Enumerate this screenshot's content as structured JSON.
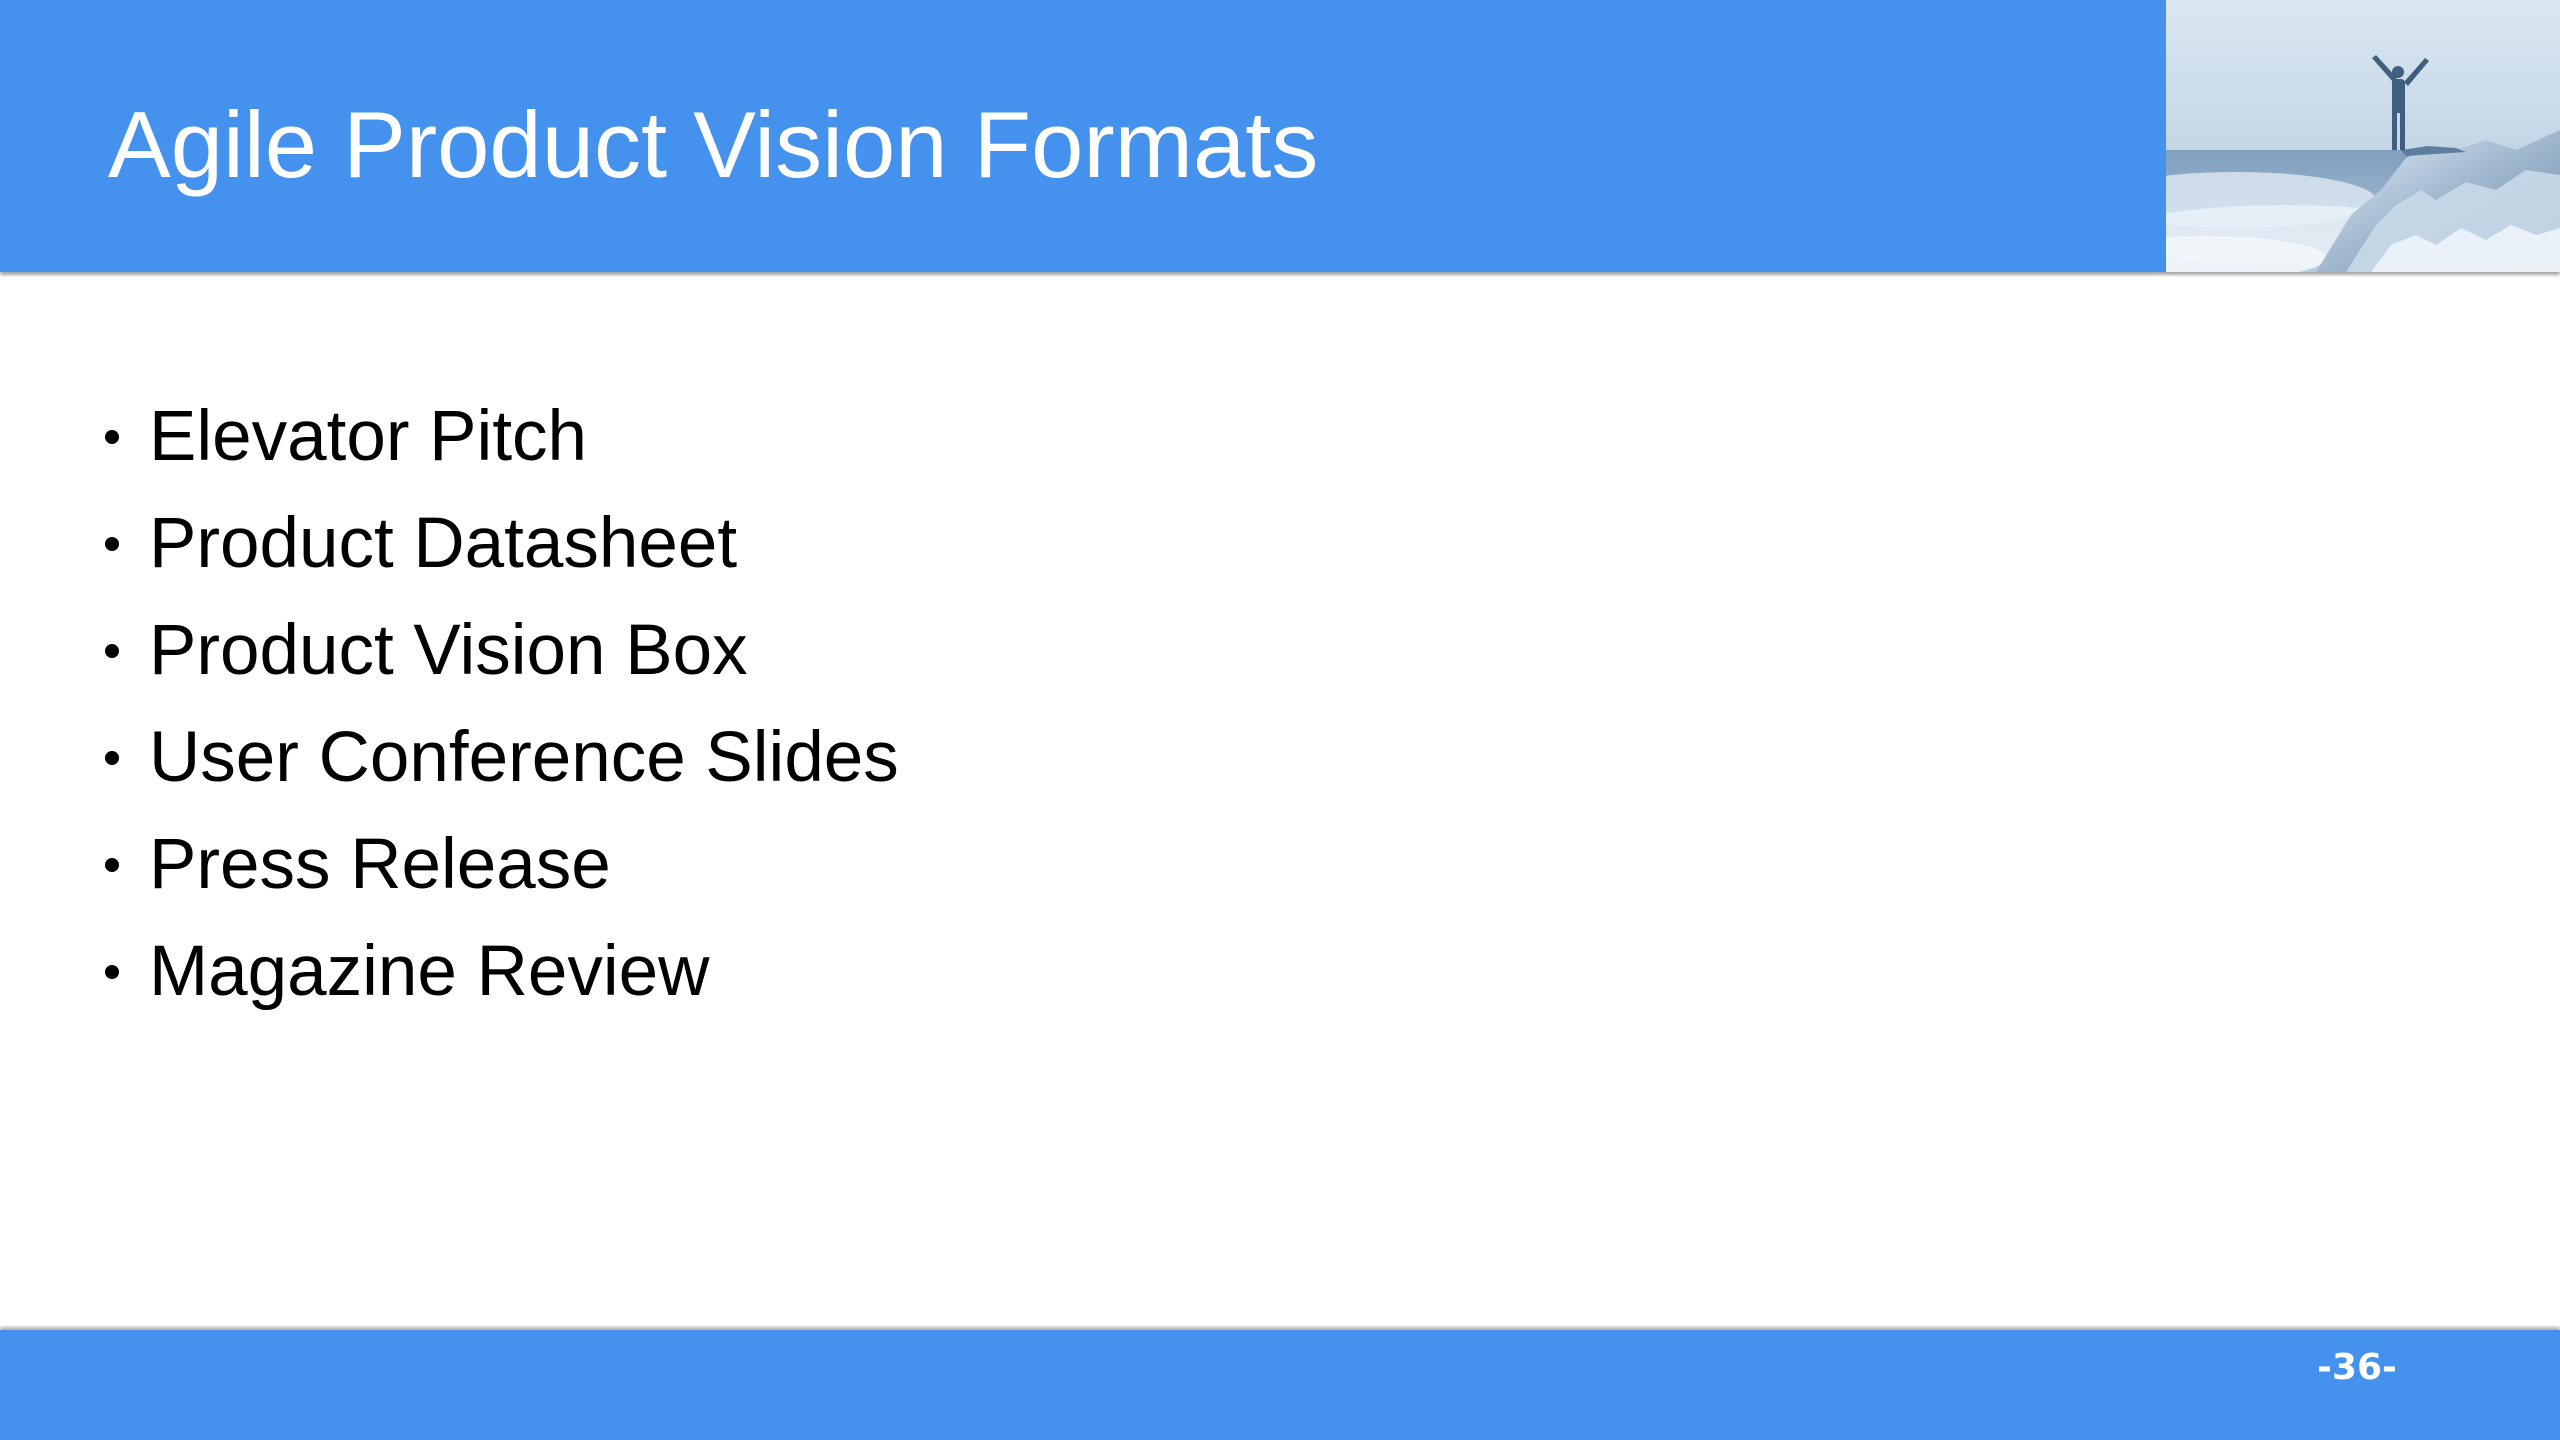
{
  "slide": {
    "title": "Agile Product Vision Formats",
    "bullets": [
      {
        "label": "Elevator Pitch"
      },
      {
        "label": "Product Datasheet"
      },
      {
        "label": "Product Vision Box"
      },
      {
        "label": "User Conference Slides"
      },
      {
        "label": "Press Release"
      },
      {
        "label": "Magazine Review"
      }
    ],
    "page_number": "-36-"
  },
  "header_image": {
    "icon": "mountain-summit-person-photo"
  },
  "colors": {
    "header_bar": "#4491ee",
    "footer_bar": "#4491ee",
    "title_text": "#ffffff",
    "body_text": "#000000"
  }
}
